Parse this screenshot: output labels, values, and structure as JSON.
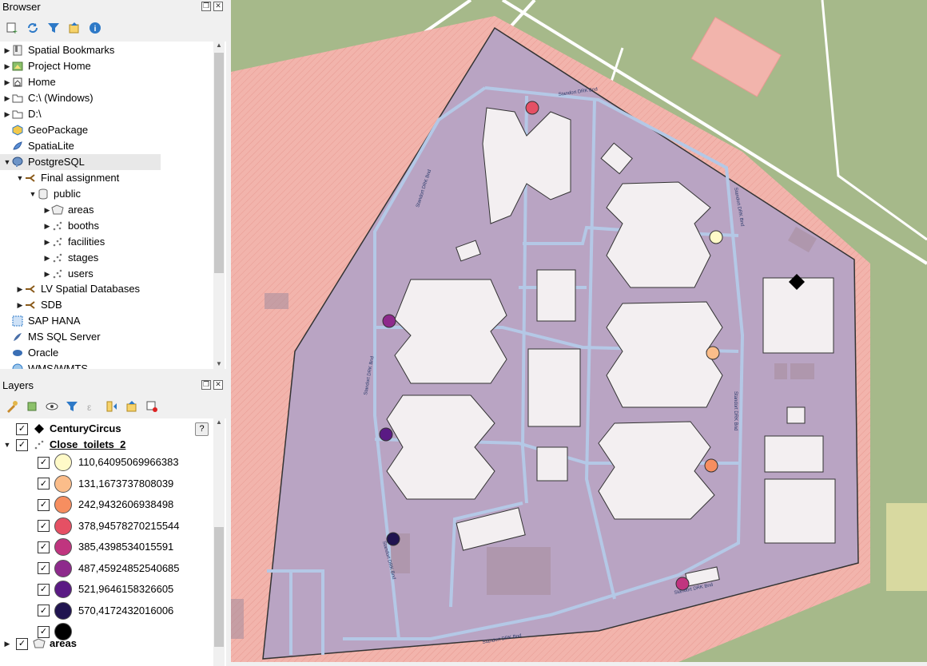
{
  "browser": {
    "title": "Browser",
    "items": [
      {
        "label": "Spatial Bookmarks"
      },
      {
        "label": "Project Home"
      },
      {
        "label": "Home"
      },
      {
        "label": "C:\\ (Windows)"
      },
      {
        "label": "D:\\"
      },
      {
        "label": "GeoPackage"
      },
      {
        "label": "SpatiaLite"
      },
      {
        "label": "PostgreSQL"
      },
      {
        "label": "Final assignment"
      },
      {
        "label": "public"
      },
      {
        "label": "areas"
      },
      {
        "label": "booths"
      },
      {
        "label": "facilities"
      },
      {
        "label": "stages"
      },
      {
        "label": "users"
      },
      {
        "label": "LV Spatial Databases"
      },
      {
        "label": "SDB"
      },
      {
        "label": "SAP HANA"
      },
      {
        "label": "MS SQL Server"
      },
      {
        "label": "Oracle"
      },
      {
        "label": "WMS/WMTS"
      }
    ]
  },
  "layers": {
    "title": "Layers",
    "century": "CenturyCircus",
    "close_toilets": "Close_toilets_2",
    "areas": "areas",
    "legend": [
      {
        "label": "110,64095069966383",
        "color": "#fffac8"
      },
      {
        "label": "131,1673737808039",
        "color": "#fbbd8a"
      },
      {
        "label": "242,9432606938498",
        "color": "#f68e60"
      },
      {
        "label": "378,94578270215544",
        "color": "#e55064"
      },
      {
        "label": "385,4398534015591",
        "color": "#c0357f"
      },
      {
        "label": "487,45924852540685",
        "color": "#8e2a8c"
      },
      {
        "label": "521,9646158326605",
        "color": "#5a1a84"
      },
      {
        "label": "570,4172432016006",
        "color": "#201450"
      },
      {
        "label": "",
        "color": "#000000"
      }
    ]
  },
  "map": {
    "road_label": "Standort DRK Bnd",
    "colors": {
      "background": "#a6b98a",
      "zone": "#f2b4ac",
      "site": "#b9a4c3",
      "paths": "#b4c8e6",
      "buildings": "#f3eff1"
    }
  }
}
